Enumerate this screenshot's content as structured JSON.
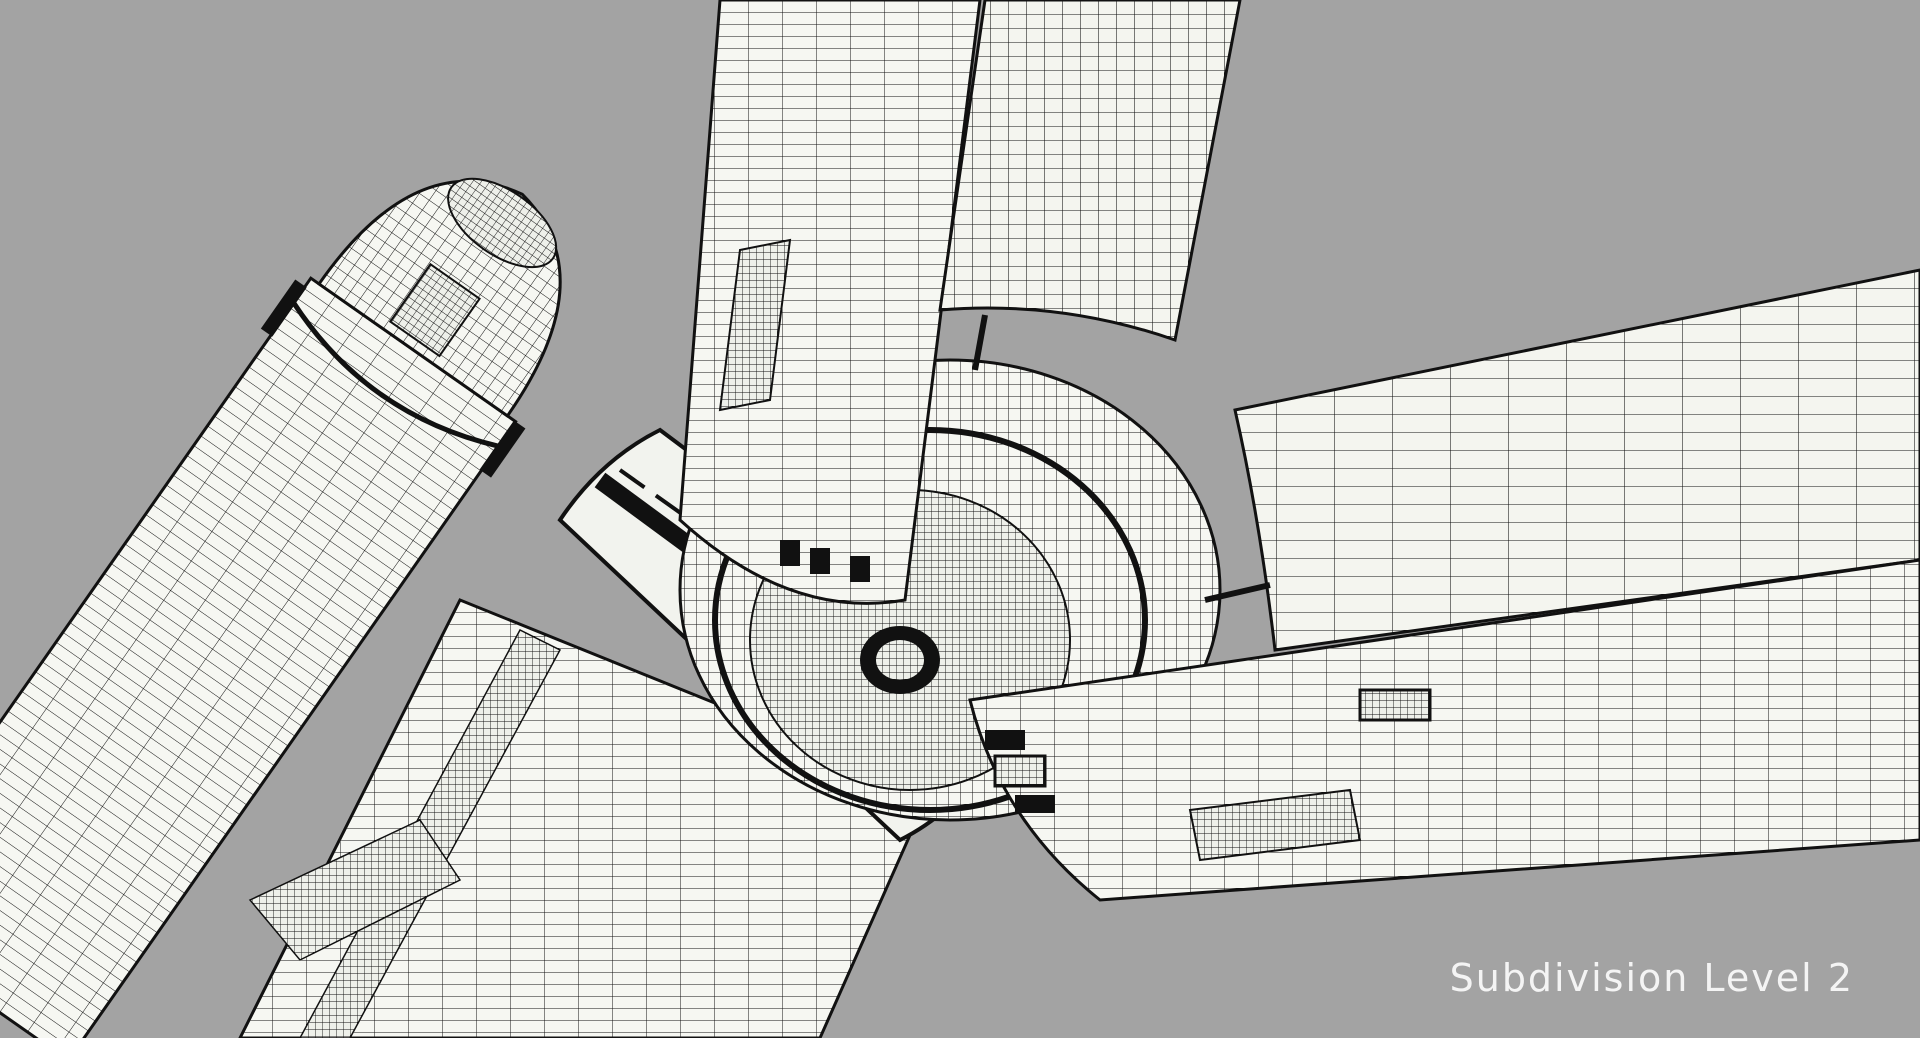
{
  "viewport": {
    "background_color": "#a3a3a3",
    "mesh_fill_color": "#f6f7f2",
    "wire_color": "#111111",
    "label": "Subdivision Level 2",
    "label_color": "#f4f4f4"
  }
}
